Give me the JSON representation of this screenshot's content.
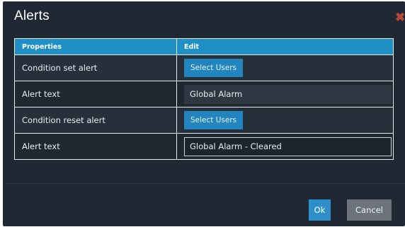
{
  "dialog": {
    "title": "Alerts",
    "close_icon": "close-icon",
    "close_glyph": "✖"
  },
  "table": {
    "headers": [
      "Properties",
      "Edit"
    ],
    "rows": [
      {
        "label": "Condition set alert",
        "type": "button",
        "value": "Select Users"
      },
      {
        "label": "Alert text",
        "type": "text",
        "value": "Global Alarm"
      },
      {
        "label": "Condition reset alert",
        "type": "button",
        "value": "Select Users"
      },
      {
        "label": "Alert text",
        "type": "text",
        "value": "Global Alarm - Cleared"
      }
    ]
  },
  "footer": {
    "ok_label": "Ok",
    "cancel_label": "Cancel"
  },
  "colors": {
    "dialog_background": "#202833",
    "header_accent": "#1f90c6",
    "primary_button": "#2e8fcb",
    "secondary_button": "#6d737a",
    "close_icon": "#b34c3a"
  }
}
